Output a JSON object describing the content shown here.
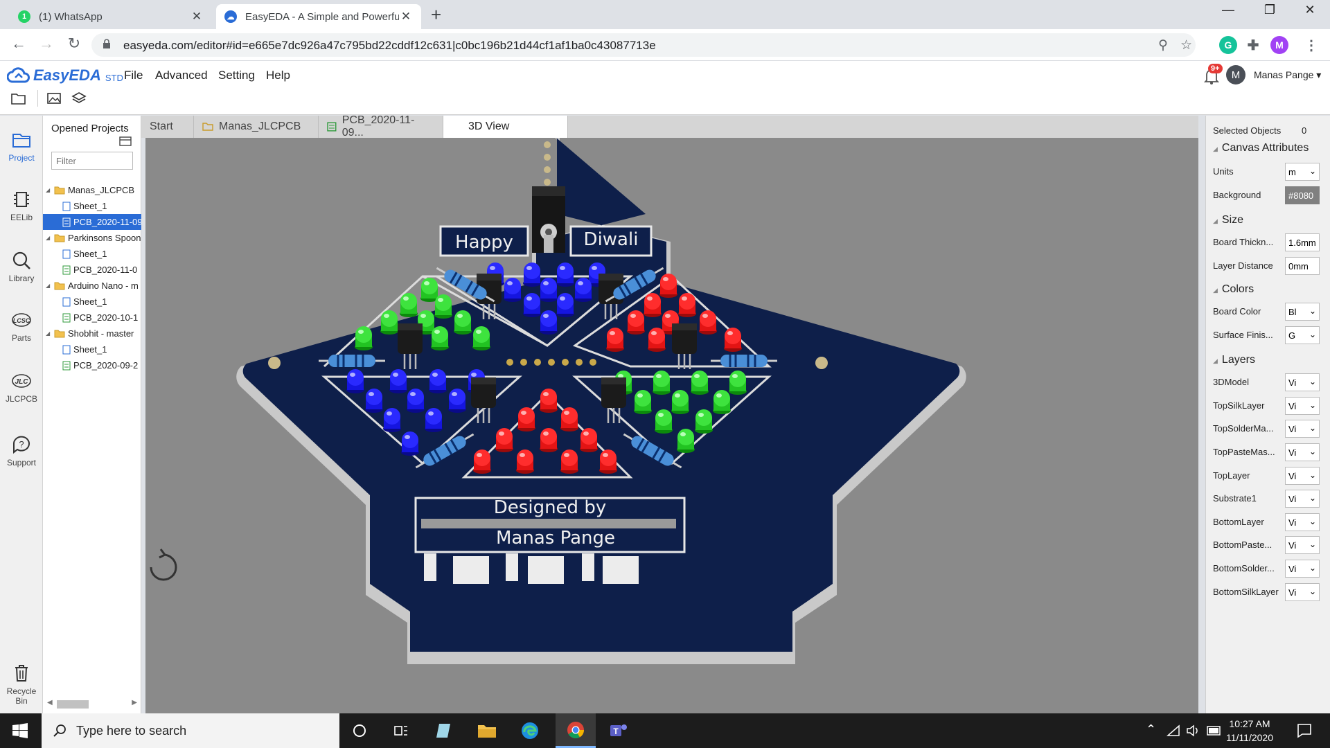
{
  "browser": {
    "tabs": [
      {
        "title": "(1) WhatsApp",
        "badge": "1"
      },
      {
        "title": "EasyEDA - A Simple and Powerful"
      }
    ],
    "url": "easyeda.com/editor#id=e665e7dc926a47c795bd22cddf12c631|c0bc196b21d44cf1af1ba0c43087713e",
    "profile_initial": "M"
  },
  "app": {
    "logo": "EasyEDA",
    "edition": "STD",
    "menu": [
      "File",
      "Advanced",
      "Setting",
      "Help"
    ],
    "notifications": "9+",
    "user_initial": "M",
    "user_name": "Manas Pange"
  },
  "leftnav": [
    {
      "label": "Project"
    },
    {
      "label": "EELib"
    },
    {
      "label": "Library"
    },
    {
      "label": "Parts"
    },
    {
      "label": "JLCPCB"
    },
    {
      "label": "Support"
    },
    {
      "label": "Recycle Bin"
    }
  ],
  "projects": {
    "title": "Opened Projects",
    "filter_placeholder": "Filter",
    "items": [
      {
        "name": "Manas_JLCPCB",
        "children": [
          "Sheet_1",
          "PCB_2020-11-09"
        ]
      },
      {
        "name": "Parkinsons Spoon",
        "children": [
          "Sheet_1",
          "PCB_2020-11-0"
        ]
      },
      {
        "name": "Arduino Nano - m",
        "children": [
          "Sheet_1",
          "PCB_2020-10-1"
        ]
      },
      {
        "name": "Shobhit - master",
        "children": [
          "Sheet_1",
          "PCB_2020-09-2"
        ]
      }
    ]
  },
  "doctabs": [
    "Start",
    "Manas_JLCPCB",
    "PCB_2020-11-09...",
    "3D View"
  ],
  "board": {
    "text_left": "Happy",
    "text_right": "Diwali",
    "text_bottom1": "Designed by",
    "text_bottom2": "Manas Pange"
  },
  "rightpanel": {
    "selected_label": "Selected Objects",
    "selected_count": "0",
    "canvas_title": "Canvas Attributes",
    "units_label": "Units",
    "units_value": "m",
    "bg_label": "Background",
    "bg_value": "#8080",
    "size_title": "Size",
    "thick_label": "Board Thickn...",
    "thick_value": "1.6mm",
    "dist_label": "Layer Distance",
    "dist_value": "0mm",
    "colors_title": "Colors",
    "bcolor_label": "Board Color",
    "bcolor_value": "Bl",
    "finish_label": "Surface Finis...",
    "finish_value": "G",
    "layers_title": "Layers",
    "layers": [
      {
        "name": "3DModel",
        "value": "Vi"
      },
      {
        "name": "TopSilkLayer",
        "value": "Vi"
      },
      {
        "name": "TopSolderMa...",
        "value": "Vi"
      },
      {
        "name": "TopPasteMas...",
        "value": "Vi"
      },
      {
        "name": "TopLayer",
        "value": "Vi"
      },
      {
        "name": "Substrate1",
        "value": "Vi"
      },
      {
        "name": "BottomLayer",
        "value": "Vi"
      },
      {
        "name": "BottomPaste...",
        "value": "Vi"
      },
      {
        "name": "BottomSolder...",
        "value": "Vi"
      },
      {
        "name": "BottomSilkLayer",
        "value": "Vi"
      }
    ]
  },
  "taskbar": {
    "search_placeholder": "Type here to search",
    "time": "10:27 AM",
    "date": "11/11/2020"
  },
  "colors": {
    "accent": "#2a6cd6",
    "board": "#0e1f4a",
    "canvas": "#8a8a8a"
  }
}
